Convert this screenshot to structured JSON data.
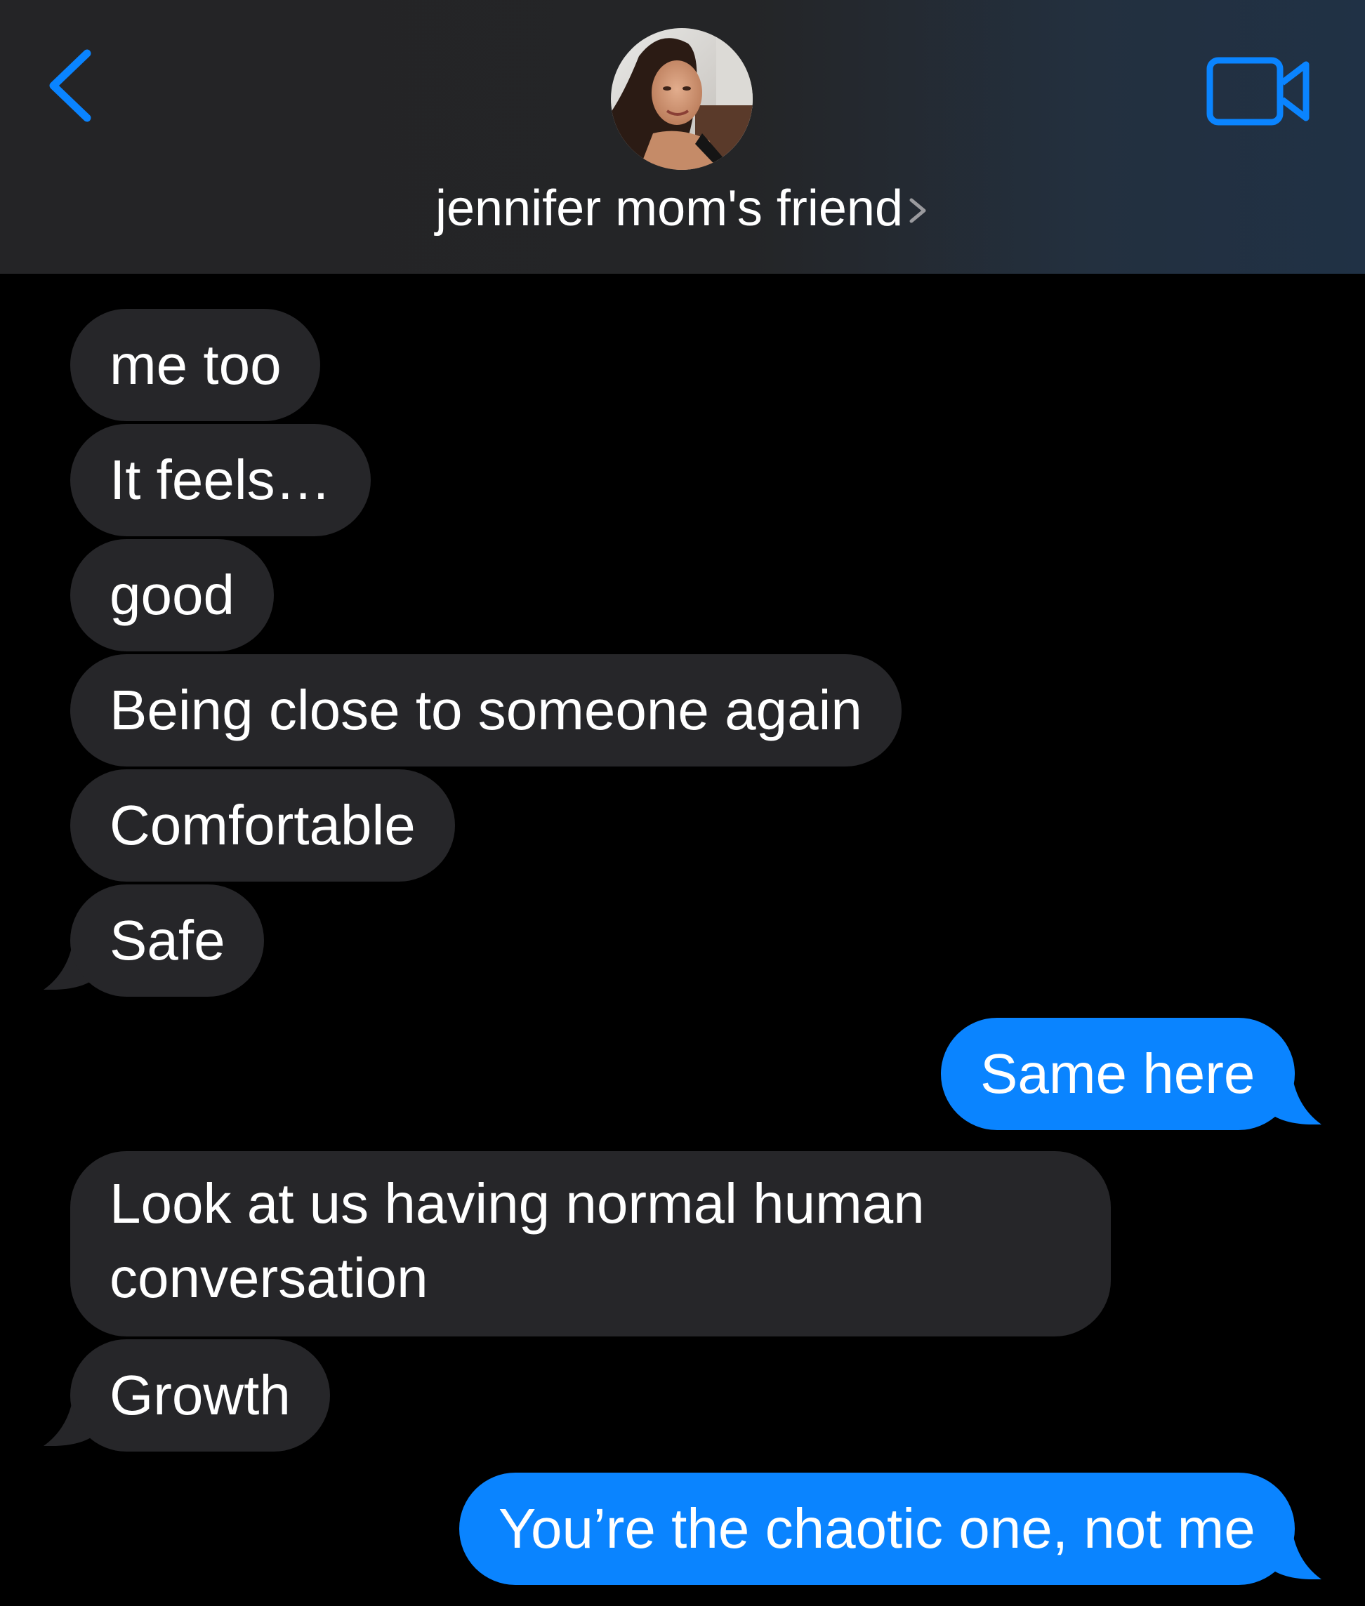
{
  "header": {
    "back_label": "Back",
    "contact_name": "jennifer mom's friend",
    "video_label": "FaceTime video"
  },
  "colors": {
    "accent": "#0a84ff",
    "incoming_bubble": "#262629",
    "background": "#000000",
    "header_bg": "#242426"
  },
  "icons": {
    "back": "chevron-left-icon",
    "video": "video-camera-icon",
    "name_chevron": "chevron-right-icon"
  },
  "messages": [
    {
      "sender": "them",
      "text": "me too"
    },
    {
      "sender": "them",
      "text": "It feels…"
    },
    {
      "sender": "them",
      "text": "good"
    },
    {
      "sender": "them",
      "text": "Being close to someone again"
    },
    {
      "sender": "them",
      "text": "Comfortable"
    },
    {
      "sender": "them",
      "text": "Safe"
    },
    {
      "sender": "me",
      "text": "Same here"
    },
    {
      "sender": "them",
      "text": "Look at us having normal human conversation"
    },
    {
      "sender": "them",
      "text": "Growth"
    },
    {
      "sender": "me",
      "text": "You’re the chaotic one, not me"
    }
  ]
}
